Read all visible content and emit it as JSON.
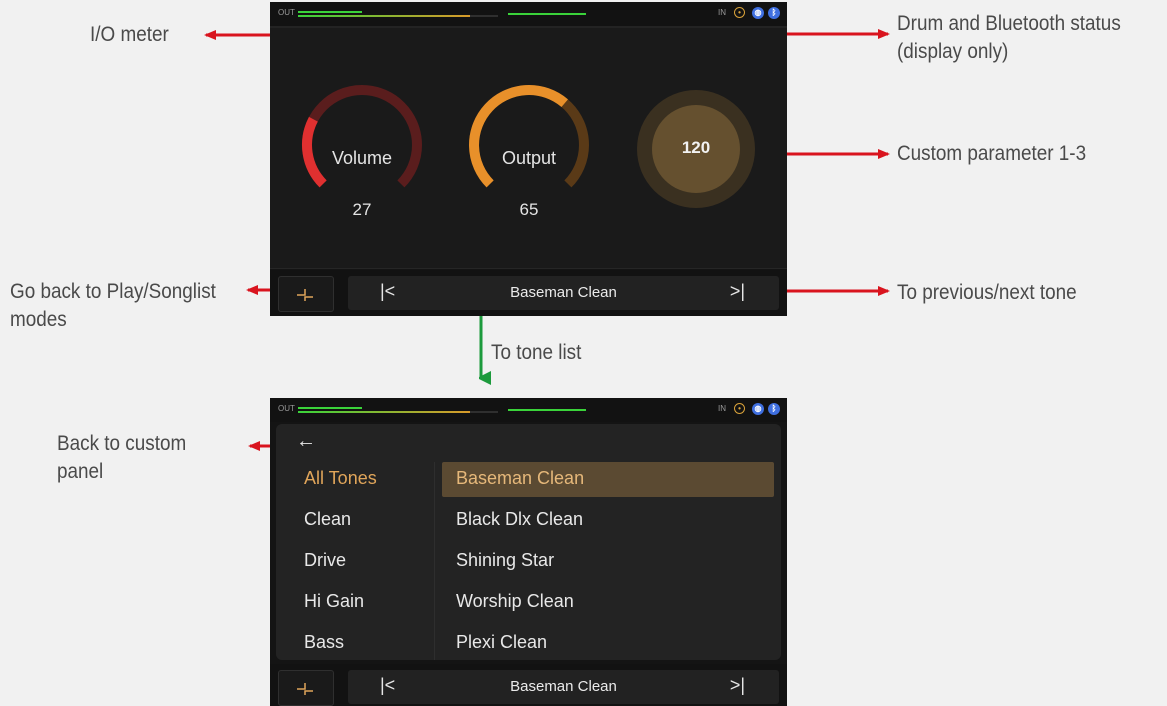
{
  "annotations": {
    "io_meter": "I/O meter",
    "status_line1": "Drum and Bluetooth status",
    "status_line2": "(display only)",
    "custom_param": "Custom parameter 1-3",
    "go_back_line1": "Go back to Play/Songlist",
    "go_back_line2": "modes",
    "prev_next": "To previous/next tone",
    "tone_list": "To tone list",
    "back_custom_line1": "Back to custom",
    "back_custom_line2": "panel"
  },
  "topbar": {
    "out_label": "OUT",
    "in_label": "IN",
    "drum_icon": "drum-icon",
    "metronome_icon": "metronome-icon",
    "bluetooth_icon": "bluetooth-icon"
  },
  "knobs": [
    {
      "label": "Volume",
      "value": "27",
      "fraction": 0.27
    },
    {
      "label": "Output",
      "value": "65",
      "fraction": 0.65
    },
    {
      "label": "",
      "value": "120"
    }
  ],
  "nav": {
    "prev_symbol": "|<",
    "next_symbol": ">|",
    "tone_name": "Baseman Clean"
  },
  "tone_list": {
    "back_symbol": "←",
    "categories": [
      "All Tones",
      "Clean",
      "Drive",
      "Hi Gain",
      "Bass"
    ],
    "active_category": 0,
    "tones": [
      "Baseman Clean",
      "Black Dlx Clean",
      "Shining Star",
      "Worship Clean",
      "Plexi Clean"
    ],
    "selected_tone": 0
  },
  "colors": {
    "red_arrow": "#d9141e",
    "green_arrow": "#1c9a3c",
    "accent": "#e0a55a",
    "meter_green": "#3ad33a",
    "meter_orange": "#d89a2a"
  }
}
